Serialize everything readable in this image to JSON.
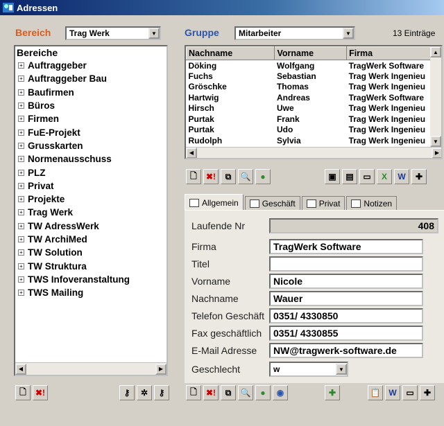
{
  "window": {
    "title": "Adressen"
  },
  "bereich": {
    "label": "Bereich",
    "value": "Trag Werk"
  },
  "gruppe": {
    "label": "Gruppe",
    "value": "Mitarbeiter",
    "count": "13 Einträge"
  },
  "tree": {
    "title": "Bereiche",
    "items": [
      "Auftraggeber",
      "Auftraggeber Bau",
      "Baufirmen",
      "Büros",
      "Firmen",
      "FuE-Projekt",
      "Grusskarten",
      "Normenausschuss",
      "PLZ",
      "Privat",
      "Projekte",
      "Trag Werk",
      "TW AdressWerk",
      "TW ArchiMed",
      "TW Solution",
      "TW Struktura",
      "TWS Infoveranstaltung",
      "TWS Mailing"
    ]
  },
  "table": {
    "headers": [
      "Nachname",
      "Vorname",
      "Firma"
    ],
    "rows": [
      [
        "Döking",
        "Wolfgang",
        "TragWerk Software"
      ],
      [
        "Fuchs",
        "Sebastian",
        "Trag Werk Ingenieu"
      ],
      [
        "Gröschke",
        "Thomas",
        "Trag Werk Ingenieu"
      ],
      [
        "Hartwig",
        "Andreas",
        "TragWerk Software"
      ],
      [
        "Hirsch",
        "Uwe",
        "Trag Werk Ingenieu"
      ],
      [
        "Purtak",
        "Frank",
        "Trag Werk Ingenieu"
      ],
      [
        "Purtak",
        "Udo",
        "Trag Werk Ingenieu"
      ],
      [
        "Rudolph",
        "Sylvia",
        "Trag Werk Ingenieu"
      ]
    ]
  },
  "tabs": [
    "Allgemein",
    "Geschäft",
    "Privat",
    "Notizen"
  ],
  "form": {
    "laufende_nr": {
      "label": "Laufende Nr",
      "value": "408"
    },
    "firma": {
      "label": "Firma",
      "value": "TragWerk Software"
    },
    "titel": {
      "label": "Titel",
      "value": ""
    },
    "vorname": {
      "label": "Vorname",
      "value": "Nicole"
    },
    "nachname": {
      "label": "Nachname",
      "value": "Wauer"
    },
    "telefon": {
      "label": "Telefon Geschäft",
      "value": "0351/ 4330850"
    },
    "fax": {
      "label": "Fax geschäftlich",
      "value": "0351/ 4330855"
    },
    "email": {
      "label": "E-Mail Adresse",
      "value": "NW@tragwerk-software.de"
    },
    "geschlecht": {
      "label": "Geschlecht",
      "value": "w"
    }
  },
  "colors": {
    "accent_orange": "#e05a1a",
    "accent_blue": "#2a54b0",
    "title_bar": "#0a246a"
  }
}
